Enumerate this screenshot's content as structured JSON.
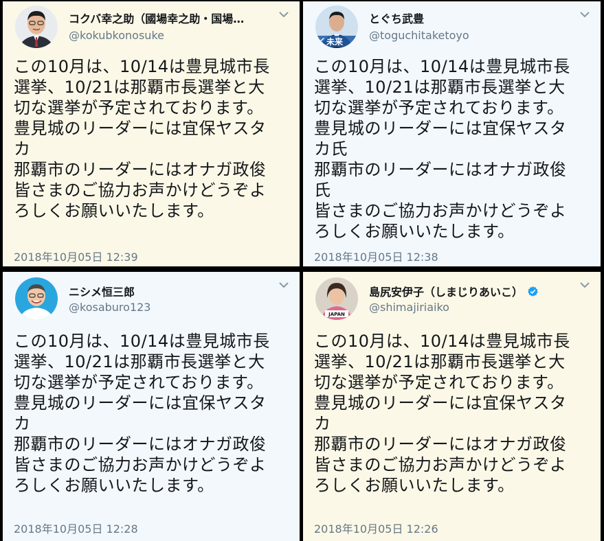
{
  "tweets": [
    {
      "name": "コクバ幸之助（國場幸之助・国場…",
      "handle": "@kokubkonosuke",
      "verified": false,
      "lines": [
        "この10月は、10/14は豊見城市長",
        "選挙、10/21は那覇市長選挙と大",
        "切な選挙が予定されております。",
        "豊見城のリーダーには宜保ヤスタ",
        "カ",
        "那覇市のリーダーにはオナガ政俊",
        "皆さまのご協力お声かけどうぞよ",
        "ろしくお願いいたします。"
      ],
      "timestamp": "2018年10月05日 12:39"
    },
    {
      "name": "とぐち武豊",
      "handle": "@toguchitaketoyo",
      "verified": false,
      "avatar_text": "く未来",
      "lines": [
        "この10月は、10/14は豊見城市長",
        "選挙、10/21は那覇市長選挙と大",
        "切な選挙が予定されております。",
        "豊見城のリーダーには宜保ヤスタ",
        "カ氏",
        "那覇市のリーダーにはオナガ政俊",
        "氏",
        "皆さまのご協力お声かけどうぞよ",
        "ろしくお願いいたします。"
      ],
      "timestamp": "2018年10月05日 12:38"
    },
    {
      "name": "ニシメ恒三郎",
      "handle": "@kosaburo123",
      "verified": false,
      "lines": [
        "この10月は、10/14は豊見城市長",
        "選挙、10/21は那覇市長選挙と大",
        "切な選挙が予定されております。",
        "豊見城のリーダーには宜保ヤスタ",
        "カ",
        "那覇市のリーダーにはオナガ政俊",
        "皆さまのご協力お声かけどうぞよ",
        "ろしくお願いいたします。"
      ],
      "timestamp": "2018年10月05日 12:28"
    },
    {
      "name": "島尻安伊子（しまじりあいこ）",
      "handle": "@shimajiriaiko",
      "verified": true,
      "avatar_text": "JAPAN",
      "lines": [
        "この10月は、10/14は豊見城市長",
        "選挙、10/21は那覇市長選挙と大",
        "切な選挙が予定されております。",
        "豊見城のリーダーには宜保ヤスタ",
        "カ",
        "那覇市のリーダーにはオナガ政俊",
        "皆さまのご協力お声かけどうぞよ",
        "ろしくお願いいたします。"
      ],
      "timestamp": "2018年10月05日 12:26"
    }
  ],
  "icons": {
    "menu": "chevron-down-icon",
    "verified": "verified-badge-icon"
  },
  "colors": {
    "card_yellow": "#fcf8e7",
    "card_blue": "#f3f8fd",
    "verified_blue": "#1da1f2",
    "meta_gray": "#657786"
  }
}
